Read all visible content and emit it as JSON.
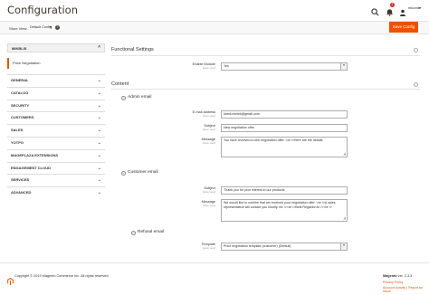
{
  "header": {
    "title": "Configuration",
    "notif_count": "1",
    "user_name": "mkomk",
    "user_caret": "▾"
  },
  "toolbar": {
    "store_view_label": "Store View:",
    "store_view_value": "Default Config",
    "help": "?",
    "save_label": "Save Config"
  },
  "sidebar": {
    "group": {
      "label": "MIKBLIS",
      "chevron": "^"
    },
    "selected_item": "Price Negotiation",
    "sections": [
      {
        "label": "GENERAL"
      },
      {
        "label": "CATALOG"
      },
      {
        "label": "SECURITY"
      },
      {
        "label": "CUSTOMERS"
      },
      {
        "label": "SALES"
      },
      {
        "label": "YOTPO"
      },
      {
        "label": "MAGEPLAZA EXTENSIONS"
      },
      {
        "label": "ENGAGEMENT CLOUD"
      },
      {
        "label": "SERVICES"
      },
      {
        "label": "ADVANCED"
      }
    ],
    "chevron": "⌄"
  },
  "functional": {
    "title": "Functional Settings",
    "enable_label": "Enable Module",
    "enable_scope": "[store view]",
    "enable_value": "Yes"
  },
  "content": {
    "title": "Content",
    "admin": {
      "title": "Admin email",
      "toggle": "−",
      "email_label": "E-mail address",
      "email_scope": "[store view]",
      "email_value": "kamil.mielek@gmail.com",
      "subject_label": "Subject",
      "subject_scope": "[store view]",
      "subject_value": "New negotiation offer",
      "message_label": "Message",
      "message_scope": "[store view]",
      "message_value": "You have received a new negotiation offer. <br />Here are the details:"
    },
    "customer": {
      "title": "Customer email",
      "toggle": "−",
      "subject_label": "Subject",
      "subject_scope": "[store view]",
      "subject_value": "Thank you for your interest in our products",
      "message_label": "Message",
      "message_scope": "[store view]",
      "message_value": "We would like to confirm that we received your negotiation offer. <br />A sales representative will contact you shortly.<br /><br />Best Regards<br /><br />"
    },
    "refusal": {
      "title": "Refusal email",
      "toggle": "−",
      "template_label": "Template",
      "template_scope": "[store view]",
      "template_value": "Price negotiation template (customer) (Default)"
    }
  },
  "footer": {
    "copyright": "Copyright © 2019 Magento Commerce Inc. All rights reserved.",
    "version_label": "Magento",
    "version_value": "ver. 2.3.3",
    "privacy": "Privacy Policy",
    "report": "Account Activity",
    "report2": "Report an Issue"
  },
  "colors": {
    "accent": "#eb5202",
    "text": "#303030"
  }
}
